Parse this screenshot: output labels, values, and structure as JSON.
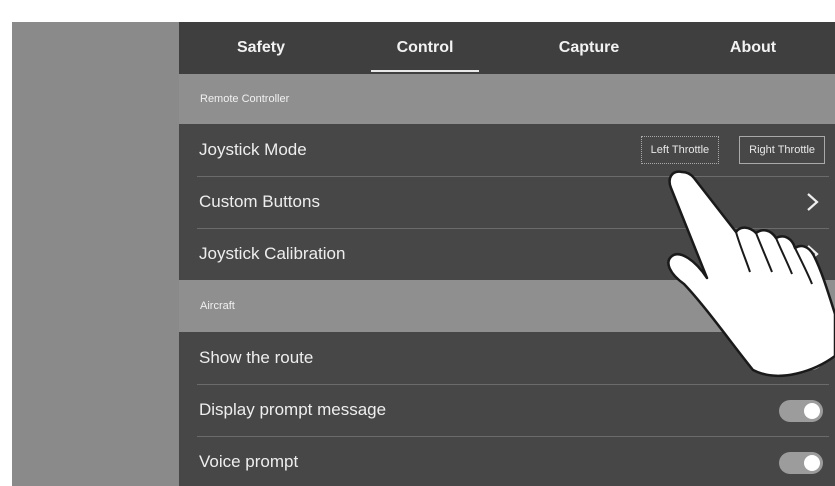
{
  "tabs": [
    {
      "label": "Safety",
      "active": false
    },
    {
      "label": "Control",
      "active": true
    },
    {
      "label": "Capture",
      "active": false
    },
    {
      "label": "About",
      "active": false
    }
  ],
  "remote_controller": {
    "header": "Remote Controller",
    "joystick_mode": {
      "label": "Joystick Mode",
      "options": [
        "Left Throttle",
        "Right Throttle"
      ],
      "selected": "Left Throttle"
    },
    "custom_buttons": {
      "label": "Custom Buttons",
      "icon": "chevron-right-icon"
    },
    "joystick_calibration": {
      "label": "Joystick Calibration",
      "icon": "chevron-right-icon"
    }
  },
  "aircraft": {
    "header": "Aircraft",
    "show_route": {
      "label": "Show the route",
      "enabled": true
    },
    "display_prompt": {
      "label": "Display prompt message",
      "enabled": true
    },
    "voice_prompt": {
      "label": "Voice prompt",
      "enabled": true
    }
  },
  "colors": {
    "panel_bg": "#444444",
    "section_header_bg": "#8f8f8f",
    "sidebar_bg": "#8a8a8a",
    "text": "#eeeeee"
  },
  "overlay": {
    "icon": "pointing-hand-icon"
  }
}
